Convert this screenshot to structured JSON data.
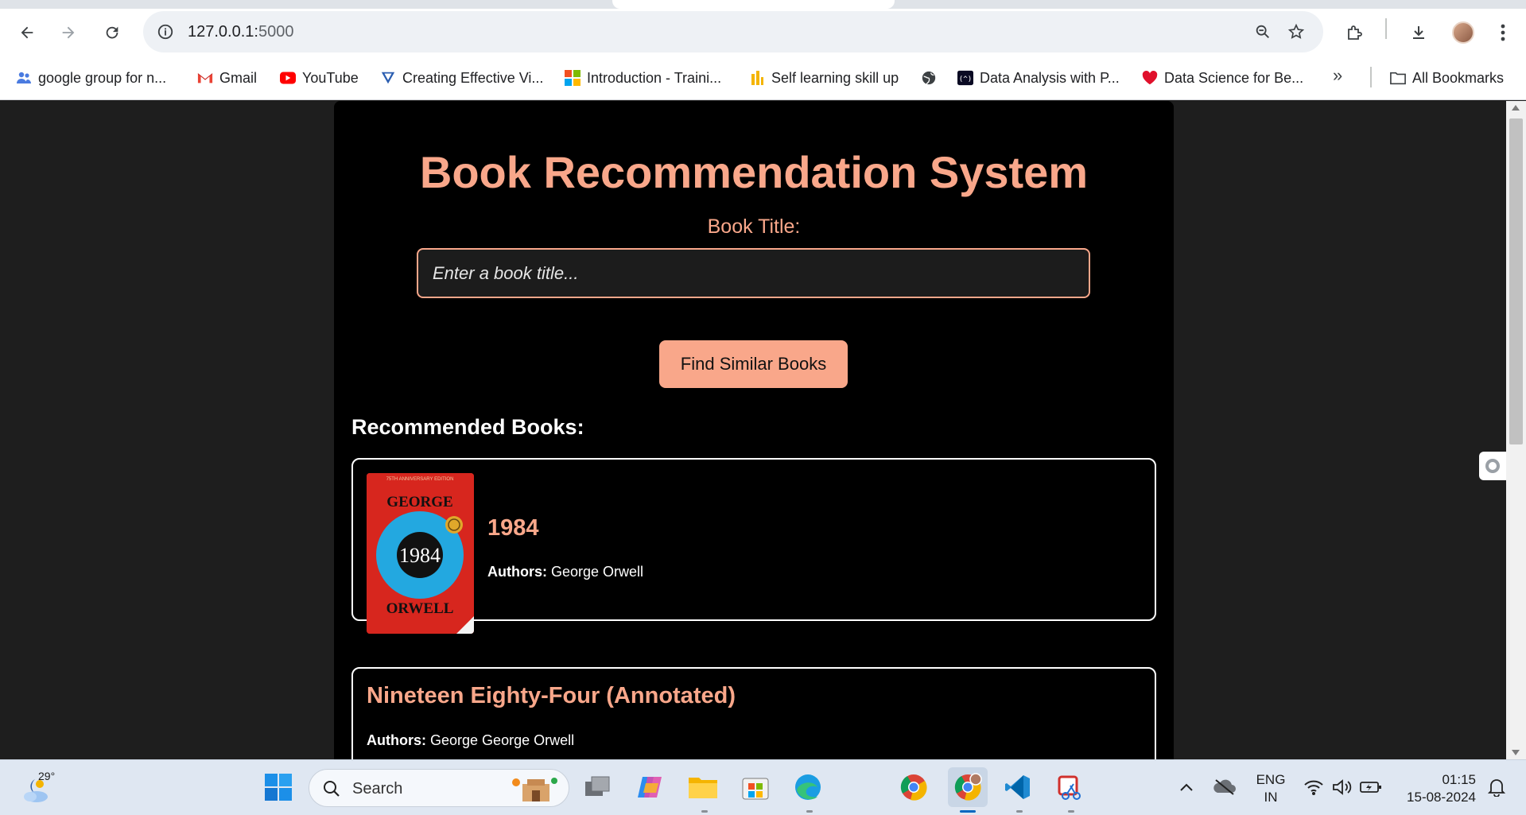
{
  "browser": {
    "url_host": "127.0.0.1:",
    "url_port": "5000",
    "bookmarks": [
      {
        "label": "google group for n...",
        "icon": "people-icon"
      },
      {
        "label": "Gmail",
        "icon": "gmail-icon"
      },
      {
        "label": "YouTube",
        "icon": "youtube-icon"
      },
      {
        "label": "Creating Effective Vi...",
        "icon": "bookmark-site-icon"
      },
      {
        "label": "Introduction - Traini...",
        "icon": "microsoft-icon"
      },
      {
        "label": "Self learning skill up",
        "icon": "chart-icon"
      },
      {
        "label": "",
        "icon": "globe-icon"
      },
      {
        "label": "Data Analysis with P...",
        "icon": "freecodecamp-icon"
      },
      {
        "label": "Data Science for Be...",
        "icon": "heart-icon"
      }
    ],
    "more_bookmarks": "»",
    "all_bookmarks": "All Bookmarks"
  },
  "page": {
    "title": "Book Recommendation System",
    "field_label": "Book Title:",
    "search_placeholder": "Enter a book title...",
    "find_button": "Find Similar Books",
    "results_heading": "Recommended Books:",
    "authors_label": "Authors:",
    "books": [
      {
        "title": "1984",
        "authors": "George Orwell",
        "cover": {
          "edition": "75TH ANNIVERSARY EDITION",
          "top": "GEORGE",
          "center": "1984",
          "bottom": "ORWELL"
        }
      },
      {
        "title": "Nineteen Eighty-Four (Annotated)",
        "authors": "George George Orwell"
      }
    ]
  },
  "taskbar": {
    "temperature": "29°",
    "search_label": "Search",
    "language_line1": "ENG",
    "language_line2": "IN",
    "time": "01:15",
    "date": "15-08-2024"
  },
  "colors": {
    "accent": "#f9a78a",
    "page_bg": "#1e1e1e",
    "container_bg": "#000000"
  }
}
